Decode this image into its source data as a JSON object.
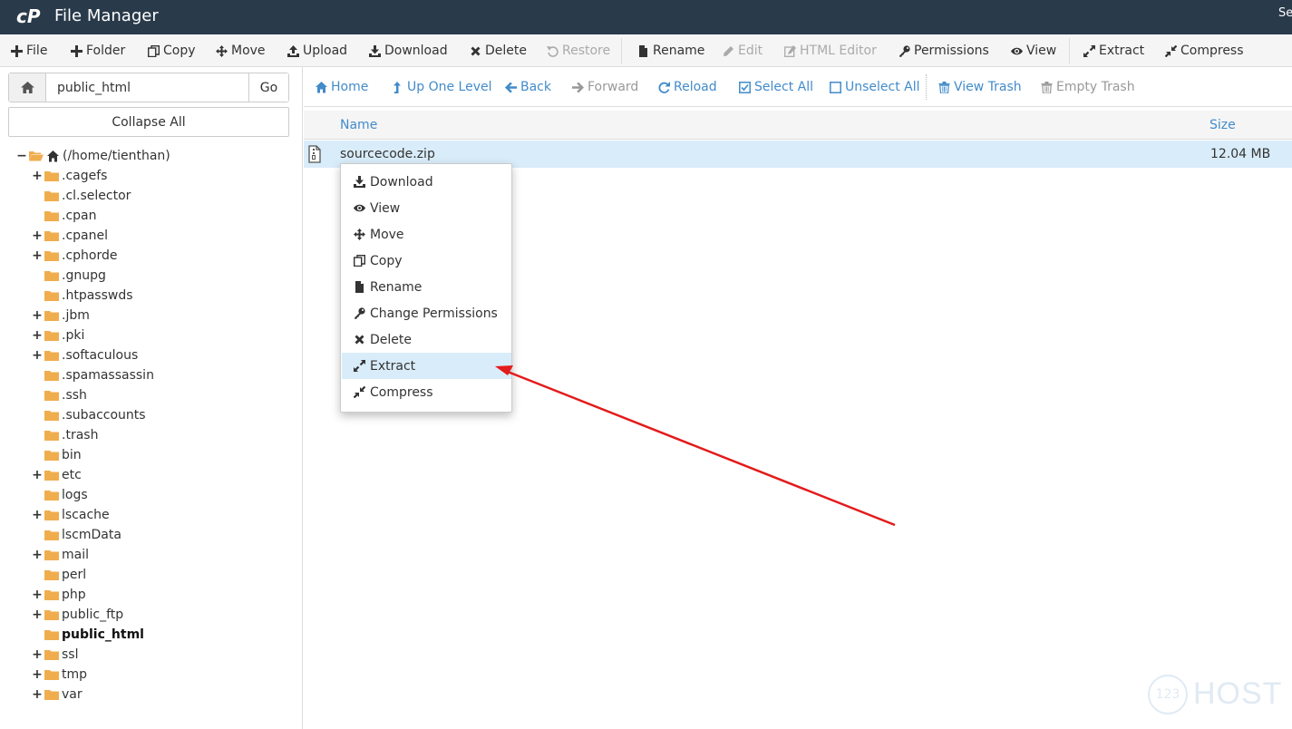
{
  "app": {
    "title": "File Manager",
    "search_partial": "Se"
  },
  "toolbar": [
    {
      "label": "File",
      "icon": "plus-icon",
      "disabled": false
    },
    {
      "label": "Folder",
      "icon": "plus-icon",
      "disabled": false
    },
    {
      "label": "Copy",
      "icon": "copy-icon",
      "disabled": false
    },
    {
      "label": "Move",
      "icon": "move-icon",
      "disabled": false
    },
    {
      "label": "Upload",
      "icon": "upload-icon",
      "disabled": false
    },
    {
      "label": "Download",
      "icon": "download-icon",
      "disabled": false
    },
    {
      "label": "Delete",
      "icon": "close-icon",
      "disabled": false
    },
    {
      "label": "Restore",
      "icon": "undo-icon",
      "disabled": true
    },
    {
      "label": "Rename",
      "icon": "file-icon",
      "disabled": false
    },
    {
      "label": "Edit",
      "icon": "pencil-icon",
      "disabled": true
    },
    {
      "label": "HTML Editor",
      "icon": "edit-square-icon",
      "disabled": true
    },
    {
      "label": "Permissions",
      "icon": "key-icon",
      "disabled": false
    },
    {
      "label": "View",
      "icon": "eye-icon",
      "disabled": false
    },
    {
      "label": "Extract",
      "icon": "expand-icon",
      "disabled": false
    },
    {
      "label": "Compress",
      "icon": "compress-icon",
      "disabled": false
    }
  ],
  "sidebar": {
    "path_value": "public_html",
    "go_label": "Go",
    "collapse_label": "Collapse All",
    "root_label": "(/home/tienthan)",
    "tree": [
      {
        "label": ".cagefs",
        "expandable": true
      },
      {
        "label": ".cl.selector",
        "expandable": false
      },
      {
        "label": ".cpan",
        "expandable": false
      },
      {
        "label": ".cpanel",
        "expandable": true
      },
      {
        "label": ".cphorde",
        "expandable": true
      },
      {
        "label": ".gnupg",
        "expandable": false
      },
      {
        "label": ".htpasswds",
        "expandable": false
      },
      {
        "label": ".jbm",
        "expandable": true
      },
      {
        "label": ".pki",
        "expandable": true
      },
      {
        "label": ".softaculous",
        "expandable": true
      },
      {
        "label": ".spamassassin",
        "expandable": false
      },
      {
        "label": ".ssh",
        "expandable": false
      },
      {
        "label": ".subaccounts",
        "expandable": false
      },
      {
        "label": ".trash",
        "expandable": false
      },
      {
        "label": "bin",
        "expandable": false
      },
      {
        "label": "etc",
        "expandable": true
      },
      {
        "label": "logs",
        "expandable": false
      },
      {
        "label": "lscache",
        "expandable": true
      },
      {
        "label": "lscmData",
        "expandable": false
      },
      {
        "label": "mail",
        "expandable": true
      },
      {
        "label": "perl",
        "expandable": false
      },
      {
        "label": "php",
        "expandable": true
      },
      {
        "label": "public_ftp",
        "expandable": true
      },
      {
        "label": "public_html",
        "expandable": false,
        "current": true
      },
      {
        "label": "ssl",
        "expandable": true
      },
      {
        "label": "tmp",
        "expandable": true
      },
      {
        "label": "var",
        "expandable": true
      }
    ]
  },
  "navbar": [
    {
      "label": "Home",
      "icon": "home-icon",
      "disabled": false
    },
    {
      "label": "Up One Level",
      "icon": "level-up-icon",
      "disabled": false
    },
    {
      "label": "Back",
      "icon": "arrow-left-icon",
      "disabled": false
    },
    {
      "label": "Forward",
      "icon": "arrow-right-icon",
      "disabled": true
    },
    {
      "label": "Reload",
      "icon": "refresh-icon",
      "disabled": false
    },
    {
      "label": "Select All",
      "icon": "check-square-icon",
      "disabled": false
    },
    {
      "label": "Unselect All",
      "icon": "square-icon",
      "disabled": false
    },
    {
      "label": "View Trash",
      "icon": "trash-icon",
      "disabled": false
    },
    {
      "label": "Empty Trash",
      "icon": "trash-icon",
      "disabled": true
    }
  ],
  "table": {
    "col_name": "Name",
    "col_size": "Size",
    "rows": [
      {
        "name": "sourcecode.zip",
        "size": "12.04 MB"
      }
    ]
  },
  "context_menu": [
    {
      "label": "Download",
      "icon": "download-icon",
      "active": false
    },
    {
      "label": "View",
      "icon": "eye-icon",
      "active": false
    },
    {
      "label": "Move",
      "icon": "move-icon",
      "active": false
    },
    {
      "label": "Copy",
      "icon": "copy-icon",
      "active": false
    },
    {
      "label": "Rename",
      "icon": "file-icon",
      "active": false
    },
    {
      "label": "Change Permissions",
      "icon": "key-icon",
      "active": false
    },
    {
      "label": "Delete",
      "icon": "close-icon",
      "active": false
    },
    {
      "label": "Extract",
      "icon": "expand-icon",
      "active": true
    },
    {
      "label": "Compress",
      "icon": "compress-icon",
      "active": false
    }
  ],
  "watermark": {
    "badge": "123",
    "text": "HOST"
  },
  "colors": {
    "header_bg": "#293a4a",
    "link_blue": "#428bca",
    "selected_row": "#d9ecf9",
    "folder": "#f0ad4e",
    "arrow_red": "#e31b1b"
  }
}
